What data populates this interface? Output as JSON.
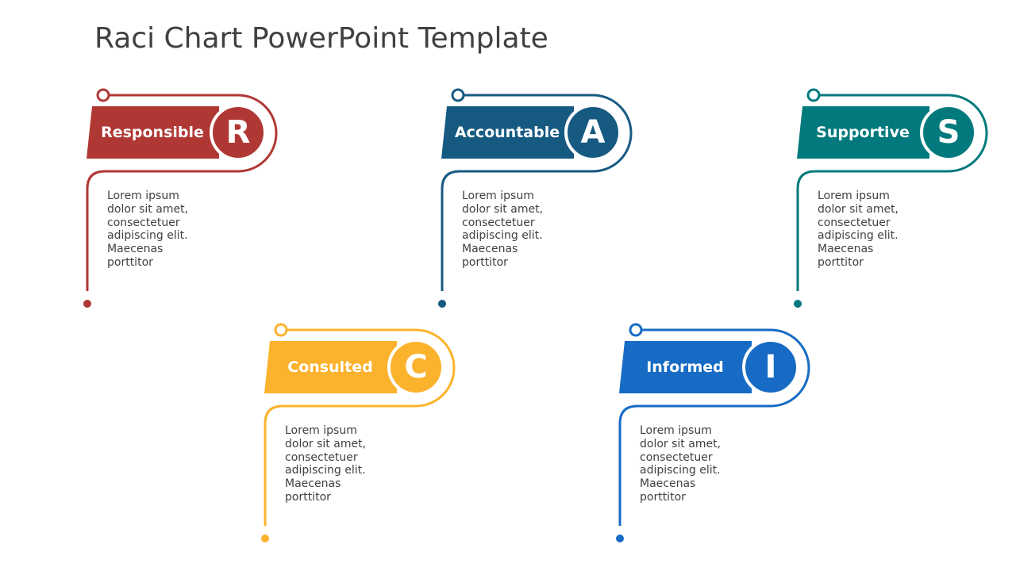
{
  "slide": {
    "title": "Raci Chart PowerPoint Template"
  },
  "cards": [
    {
      "id": "responsible",
      "label": "Responsible",
      "letter": "R",
      "color": "#B03834",
      "description": "Lorem ipsum dolor sit amet, consectetuer adipiscing elit. Maecenas porttitor"
    },
    {
      "id": "accountable",
      "label": "Accountable",
      "letter": "A",
      "color": "#165A82",
      "description": "Lorem ipsum dolor sit amet, consectetuer adipiscing elit. Maecenas porttitor"
    },
    {
      "id": "supportive",
      "label": "Supportive",
      "letter": "S",
      "color": "#027A7D",
      "description": "Lorem ipsum dolor sit amet, consectetuer adipiscing elit. Maecenas porttitor"
    },
    {
      "id": "consulted",
      "label": "Consulted",
      "letter": "C",
      "color": "#FBB22D",
      "description": "Lorem ipsum dolor sit amet, consectetuer adipiscing elit. Maecenas porttitor"
    },
    {
      "id": "informed",
      "label": "Informed",
      "letter": "I",
      "color": "#176BC4",
      "description": "Lorem ipsum dolor sit amet, consectetuer adipiscing elit. Maecenas porttitor"
    }
  ]
}
